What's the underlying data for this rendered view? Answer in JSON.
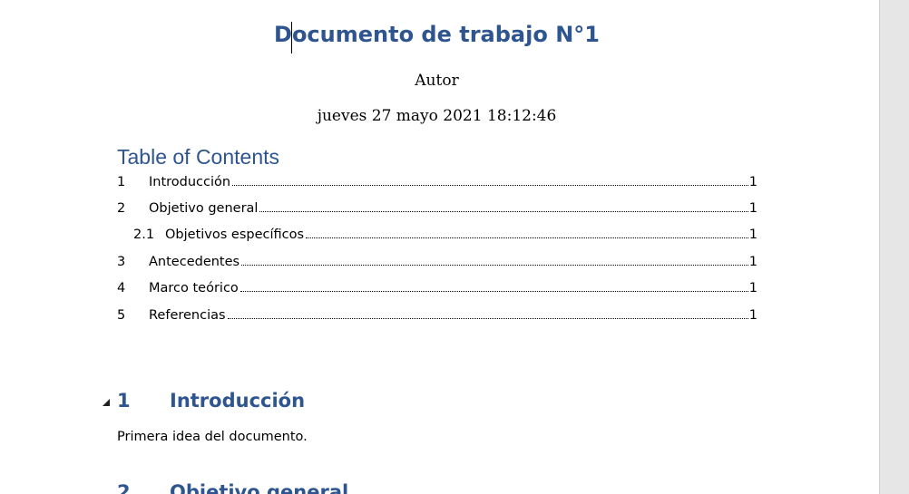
{
  "document": {
    "title": "Documento de trabajo N°1",
    "author": "Autor",
    "date": "jueves 27 mayo 2021 18:12:46"
  },
  "toc": {
    "heading": "Table of Contents",
    "entries": [
      {
        "number": "1",
        "label": "Introducción",
        "page": "1",
        "level": 1
      },
      {
        "number": "2",
        "label": "Objetivo general",
        "page": "1",
        "level": 1
      },
      {
        "number": "2.1",
        "label": "Objetivos específicos",
        "page": "1",
        "level": 2
      },
      {
        "number": "3",
        "label": "Antecedentes",
        "page": "1",
        "level": 1
      },
      {
        "number": "4",
        "label": "Marco teórico",
        "page": "1",
        "level": 1
      },
      {
        "number": "5",
        "label": "Referencias",
        "page": "1",
        "level": 1
      }
    ]
  },
  "body": {
    "sections": [
      {
        "number": "1",
        "heading": "Introducción",
        "text": "Primera idea del documento."
      },
      {
        "number": "2",
        "heading": "Objetivo general"
      }
    ]
  },
  "colors": {
    "heading": "#2e5590",
    "text": "#000000",
    "gutter": "#e6e6e6"
  },
  "icons": {
    "section_toggle": "collapse-triangle-icon"
  }
}
